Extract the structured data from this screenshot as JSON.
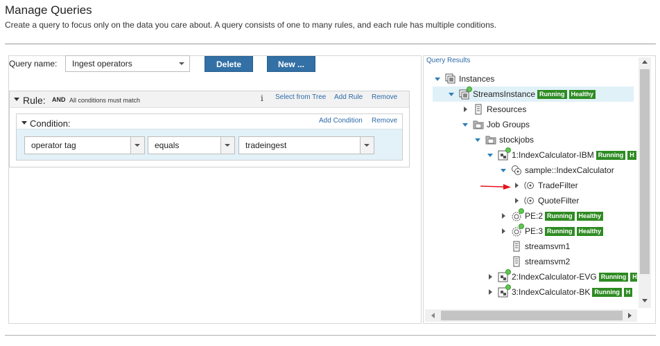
{
  "page": {
    "title": "Manage Queries",
    "description": "Create a query to focus only on the data you care about. A query consists of one to many rules, and each rule has multiple conditions."
  },
  "query": {
    "name_label": "Query name:",
    "name_value": "Ingest operators",
    "delete_label": "Delete",
    "new_label": "New ..."
  },
  "rule": {
    "label": "Rule:",
    "operator": "AND",
    "hint": "All conditions must match",
    "info_glyph": "i",
    "select_from_tree": "Select from Tree",
    "add_rule": "Add Rule",
    "remove": "Remove"
  },
  "condition": {
    "label": "Condition:",
    "add_condition": "Add Condition",
    "remove": "Remove",
    "field": "operator tag",
    "comparator": "equals",
    "value": "tradeingest"
  },
  "results": {
    "label": "Query Results",
    "badges": {
      "running": "Running",
      "healthy": "Healthy",
      "cut": "H"
    },
    "tree": {
      "instances": "Instances",
      "instance": "StreamsInstance",
      "resources": "Resources",
      "job_groups": "Job Groups",
      "stockjobs": "stockjobs",
      "job_ibm": "1:IndexCalculator-IBM",
      "composite": "sample::IndexCalculator",
      "trade_filter": "TradeFilter",
      "quote_filter": "QuoteFilter",
      "pe2": "PE:2",
      "pe3": "PE:3",
      "svm1": "streamsvm1",
      "svm2": "streamsvm2",
      "job_evg": "2:IndexCalculator-EVG",
      "job_bk": "3:IndexCalculator-BK"
    }
  },
  "colors": {
    "button": "#3270a6",
    "link": "#2d6aa6",
    "badge": "#2e8b23",
    "selected_row": "#e1f1f8",
    "annotation_arrow": "#e3141b"
  }
}
